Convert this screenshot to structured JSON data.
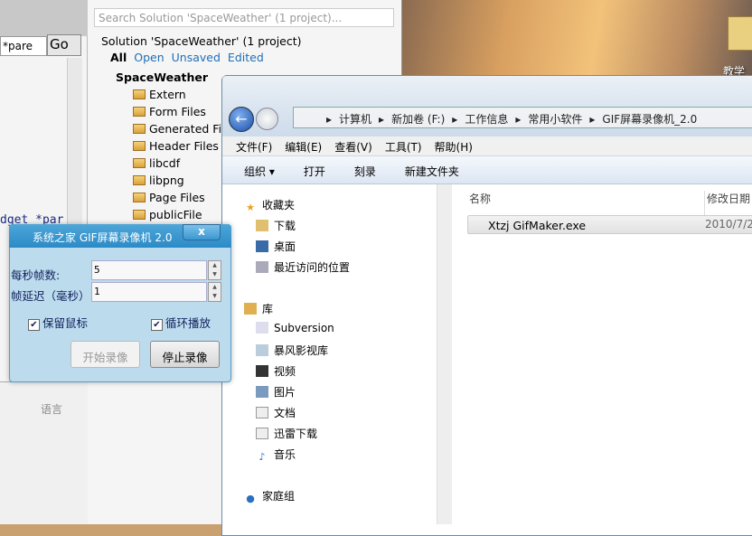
{
  "desktop": {
    "icon_label": "教学软"
  },
  "vs": {
    "combo_value": "*pare",
    "go_label": "Go",
    "code_line": "dget *par",
    "lang_label": "语言"
  },
  "solution_explorer": {
    "search_placeholder": "Search Solution 'SpaceWeather' (1 project)...",
    "solution_title": "Solution 'SpaceWeather' (1 project)",
    "filters": [
      "All",
      "Open",
      "Unsaved",
      "Edited"
    ],
    "project": "SpaceWeather",
    "folders": [
      "Extern",
      "Form Files",
      "Generated Files",
      "Header Files",
      "libcdf",
      "libpng",
      "Page Files",
      "publicFile"
    ]
  },
  "gif_dialog": {
    "title": "系统之家 GIF屏幕录像机 2.0",
    "close": "x",
    "fps_label": "每秒帧数:",
    "fps_value": "5",
    "delay_label": "帧延迟（毫秒）",
    "delay_value": "1",
    "keep_cursor": {
      "label": "保留鼠标",
      "checked": true
    },
    "loop": {
      "label": "循环播放",
      "checked": true
    },
    "start_button": "开始录像",
    "stop_button": "停止录像"
  },
  "explorer": {
    "breadcrumb": [
      "计算机",
      "新加卷 (F:)",
      "工作信息",
      "常用小软件",
      "GIF屏幕录像机_2.0"
    ],
    "menu": [
      "文件(F)",
      "编辑(E)",
      "查看(V)",
      "工具(T)",
      "帮助(H)"
    ],
    "toolbar": [
      "组织 ▾",
      "打开",
      "刻录",
      "新建文件夹"
    ],
    "nav": {
      "favorites": "收藏夹",
      "favorites_items": [
        "下载",
        "桌面",
        "最近访问的位置"
      ],
      "libraries": "库",
      "library_items": [
        "Subversion",
        "暴风影视库",
        "视频",
        "图片",
        "文档",
        "迅雷下载",
        "音乐"
      ],
      "homegroup": "家庭组"
    },
    "columns": {
      "name": "名称",
      "date": "修改日期"
    },
    "files": [
      {
        "name": "Xtzj GifMaker.exe",
        "date": "2010/7/2"
      }
    ]
  }
}
